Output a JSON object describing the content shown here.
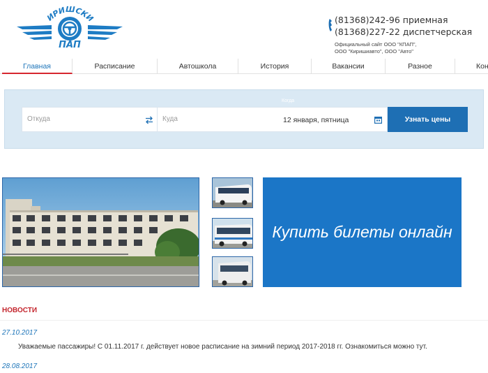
{
  "header": {
    "logo": {
      "text_top": "КИРИШСКИЕ",
      "text_bottom": "ПАП"
    },
    "phones": [
      "(81368)242-96 приемная",
      "(81368)227-22 диспетчерская"
    ],
    "site_info": [
      "Официальный сайт ООО \"КПАП\",",
      "ООО \"Киришиавто\", ООО \"Авто\""
    ]
  },
  "nav": {
    "items": [
      {
        "label": "Главная",
        "active": true
      },
      {
        "label": "Расписание"
      },
      {
        "label": "Автошкола"
      },
      {
        "label": "История"
      },
      {
        "label": "Вакансии"
      },
      {
        "label": "Разное"
      },
      {
        "label": "Кон"
      }
    ]
  },
  "search": {
    "date_caption": "Когда",
    "from_placeholder": "Откуда",
    "to_placeholder": "Куда",
    "date_value": "12 января, пятница",
    "submit_label": "Узнать цены"
  },
  "banner": {
    "buy_label": "Купить билеты онлайн"
  },
  "news": {
    "title": "НОВОСТИ",
    "items": [
      {
        "date": "27.10.2017",
        "text": "Уважаемые пассажиры! С 01.11.2017 г. действует новое расписание на зимний период 2017-2018 гг. Ознакомиться можно тут."
      },
      {
        "date": "28.08.2017",
        "text": ""
      }
    ]
  },
  "colors": {
    "brand_blue": "#1e6fb4",
    "banner_blue": "#1b76c7",
    "nav_active": "#1c74b9",
    "accent_red": "#c4262e",
    "panel_bg": "#dae9f4"
  }
}
